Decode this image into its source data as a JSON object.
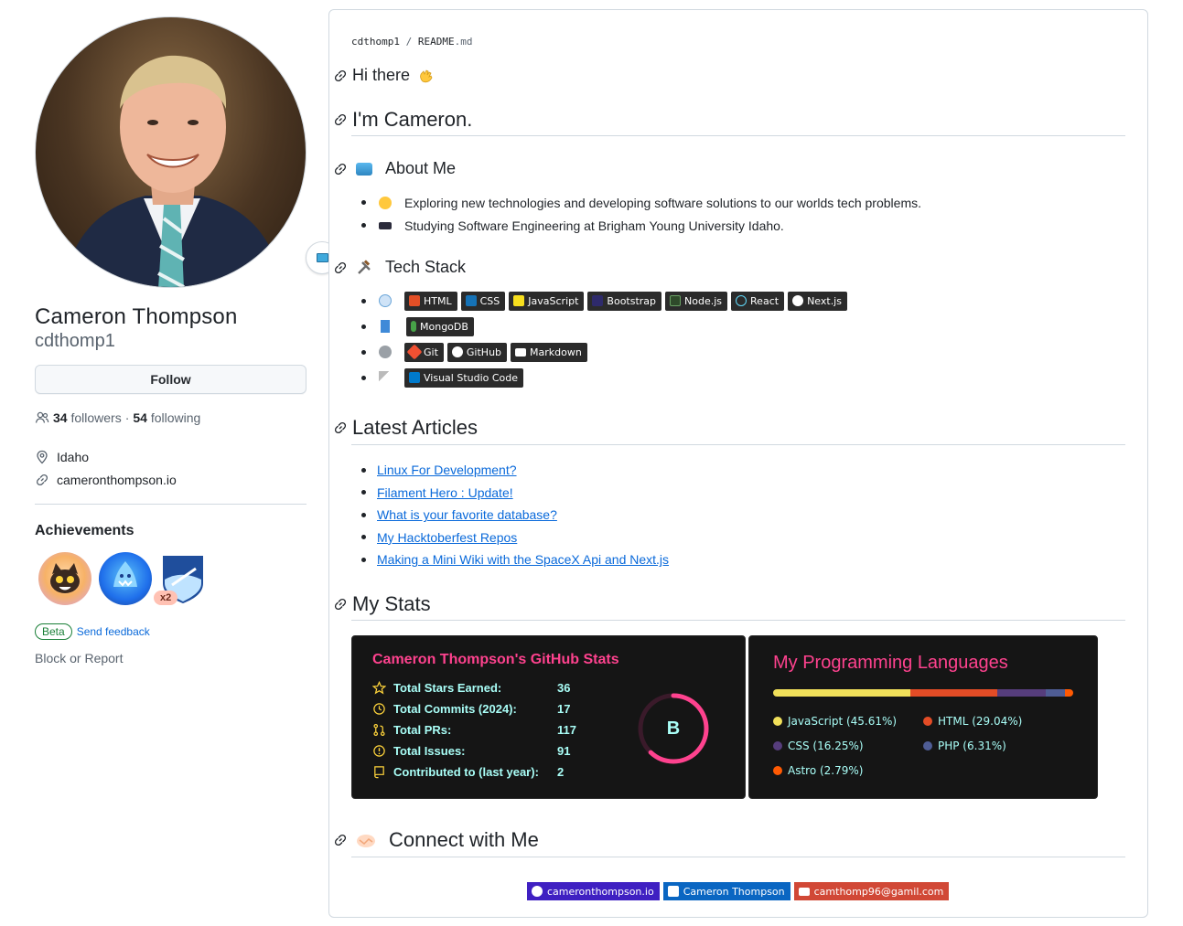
{
  "profile": {
    "name": "Cameron Thompson",
    "login": "cdthomp1",
    "follow_label": "Follow",
    "followers_count": "34",
    "followers_label": "followers",
    "separator": "·",
    "following_count": "54",
    "following_label": "following",
    "location": "Idaho",
    "website": "cameronthompson.io",
    "achievements_title": "Achievements",
    "achievement_multiplier": "x2",
    "beta_label": "Beta",
    "feedback_label": "Send feedback",
    "block_label": "Block or Report"
  },
  "readme": {
    "crumb_user": "cdthomp1",
    "crumb_sep": "/",
    "crumb_file": "README",
    "crumb_ext": ".md",
    "greeting": "Hi there",
    "intro": "I'm Cameron.",
    "about_title": "About Me",
    "about_items": [
      "Exploring new technologies and developing software solutions to our worlds tech problems.",
      "Studying Software Engineering at Brigham Young University Idaho."
    ],
    "tech_title": "Tech Stack",
    "tech_rows": [
      [
        "HTML",
        "CSS",
        "JavaScript",
        "Bootstrap",
        "Node.js",
        "React",
        "Next.js"
      ],
      [
        "MongoDB"
      ],
      [
        "Git",
        "GitHub",
        "Markdown"
      ],
      [
        "Visual Studio Code"
      ]
    ],
    "articles_title": "Latest Articles",
    "articles": [
      "Linux For Development?",
      "Filament Hero : Update!",
      "What is your favorite database?",
      "My Hacktoberfest Repos",
      "Making a Mini Wiki with the SpaceX Api and Next.js"
    ],
    "stats_title": "My Stats",
    "stats_card": {
      "title": "Cameron Thompson's GitHub Stats",
      "rows": [
        {
          "label": "Total Stars Earned:",
          "value": "36"
        },
        {
          "label": "Total Commits (2024):",
          "value": "17"
        },
        {
          "label": "Total PRs:",
          "value": "117"
        },
        {
          "label": "Total Issues:",
          "value": "91"
        },
        {
          "label": "Contributed to (last year):",
          "value": "2"
        }
      ],
      "grade": "B",
      "ring_progress": 0.62
    },
    "languages_card": {
      "title": "My Programming Languages",
      "languages": [
        {
          "label": "JavaScript (45.61%)",
          "percent": 45.61,
          "color": "#f1e05a"
        },
        {
          "label": "HTML (29.04%)",
          "percent": 29.04,
          "color": "#e34c26"
        },
        {
          "label": "CSS (16.25%)",
          "percent": 16.25,
          "color": "#563d7c"
        },
        {
          "label": "PHP (6.31%)",
          "percent": 6.31,
          "color": "#4f5d95"
        },
        {
          "label": "Astro (2.79%)",
          "percent": 2.79,
          "color": "#ff5a03"
        }
      ]
    },
    "connect_title": "Connect with Me",
    "connect_links": [
      {
        "label": "cameronthompson.io",
        "color": "#3f20c2"
      },
      {
        "label": "Cameron Thompson",
        "color": "#0a66c2"
      },
      {
        "label": "camthomp96@gamil.com",
        "color": "#d14836"
      }
    ]
  },
  "colors": {
    "accent": "#fe428e",
    "stat_text": "#a9fef7",
    "link": "#0969da"
  }
}
